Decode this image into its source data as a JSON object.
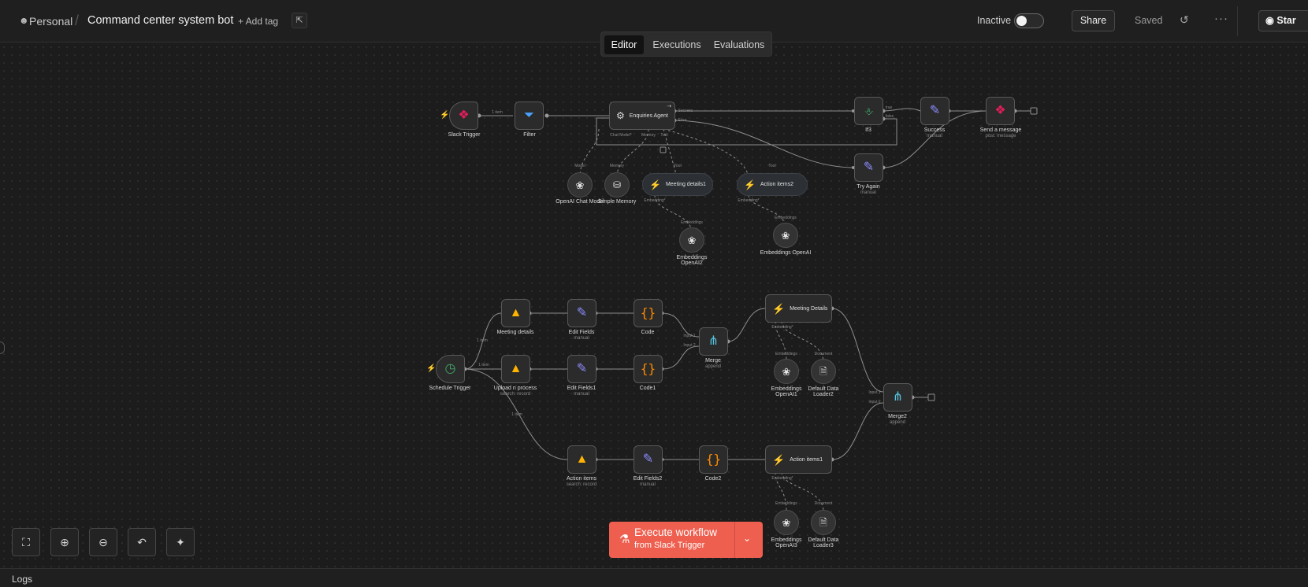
{
  "header": {
    "workspace": "Personal",
    "title": "Command center system bot",
    "add_tag": "+ Add tag",
    "status_label": "Inactive",
    "active": false,
    "share": "Share",
    "saved": "Saved",
    "star": "Star"
  },
  "tabs": [
    {
      "label": "Editor",
      "active": true
    },
    {
      "label": "Executions",
      "active": false
    },
    {
      "label": "Evaluations",
      "active": false
    }
  ],
  "nodes": {
    "slack_trigger": {
      "label": "Slack Trigger"
    },
    "filter": {
      "label": "Filter"
    },
    "enquiries_agent": {
      "label": "Enquiries Agent"
    },
    "if3": {
      "label": "If3"
    },
    "success": {
      "label": "Success",
      "sub": "manual"
    },
    "send_message": {
      "label": "Send a message",
      "sub": "post: message"
    },
    "try_again": {
      "label": "Try Again",
      "sub": "manual"
    },
    "openai_chat_model": {
      "label": "OpenAI Chat Model"
    },
    "simple_memory": {
      "label": "Simple Memory"
    },
    "meeting_details1": {
      "label": "Meeting details1"
    },
    "action_items2": {
      "label": "Action items2"
    },
    "embeddings_openai2": {
      "label": "Embeddings OpenAI2"
    },
    "embeddings_openai": {
      "label": "Embeddings OpenAI"
    },
    "schedule_trigger": {
      "label": "Schedule Trigger"
    },
    "meeting_details": {
      "label": "Meeting details"
    },
    "upload_n_process": {
      "label": "Upload n process",
      "sub": "search: record"
    },
    "action_items": {
      "label": "Action items",
      "sub": "search: record"
    },
    "edit_fields": {
      "label": "Edit Fields",
      "sub": "manual"
    },
    "edit_fields1": {
      "label": "Edit Fields1",
      "sub": "manual"
    },
    "edit_fields2": {
      "label": "Edit Fields2",
      "sub": "manual"
    },
    "code": {
      "label": "Code"
    },
    "code1": {
      "label": "Code1"
    },
    "code2": {
      "label": "Code2"
    },
    "merge": {
      "label": "Merge",
      "sub": "append"
    },
    "meeting_details_store": {
      "label": "Meeting Details"
    },
    "action_items1": {
      "label": "Action items1"
    },
    "embeddings_openai1": {
      "label": "Embeddings OpenAI1"
    },
    "default_data_loader2": {
      "label": "Default Data Loader2"
    },
    "embeddings_openai3": {
      "label": "Embeddings OpenAI3"
    },
    "default_data_loader3": {
      "label": "Default Data Loader3"
    },
    "merge2": {
      "label": "Merge2",
      "sub": "append"
    }
  },
  "edge_labels": {
    "item": "1 item",
    "items": "1 item",
    "success": "Success",
    "error": "Error",
    "true": "true",
    "false": "false",
    "chat_model": "Chat Model*",
    "memory": "Memory",
    "tool": "Tool",
    "model": "Model",
    "embedding": "Embedding*",
    "embeddings": "Embeddings",
    "document": "Document",
    "input1": "Input 1",
    "input2": "Input 2"
  },
  "execute": {
    "title": "Execute workflow",
    "sub": "from Slack Trigger"
  },
  "logs": "Logs",
  "colors": {
    "accent": "#ee5f4f",
    "airtable": "#ffb400",
    "code": "#ff8a00",
    "merge": "#54c4e0",
    "vector": "#3fae6b",
    "edit": "#8c8cff"
  }
}
